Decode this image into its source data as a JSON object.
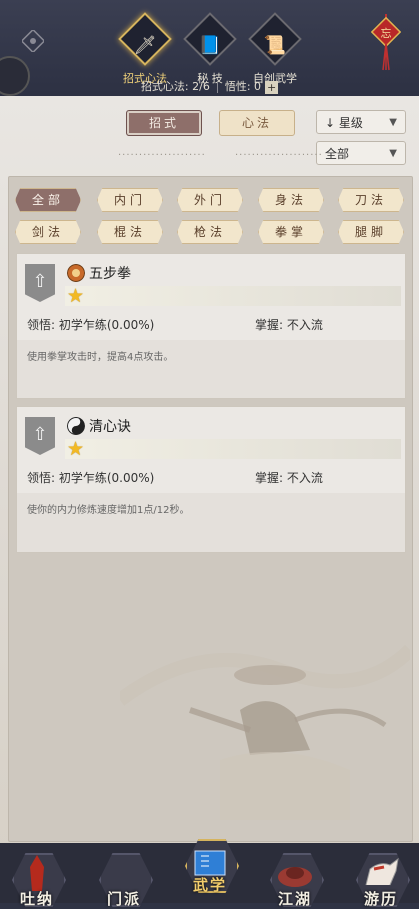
{
  "header": {
    "tabs": [
      {
        "label": "招式心法",
        "icon": "sword-icon",
        "active": true
      },
      {
        "label": "秘 技",
        "icon": "book-icon",
        "active": false
      },
      {
        "label": "自创武学",
        "icon": "scroll-icon",
        "active": false
      }
    ],
    "stat_moves": "招式心法: 2/6",
    "stat_insight": "悟性: 0",
    "plus": "+",
    "charm_char": "忘"
  },
  "toggle": {
    "moves": "招式",
    "heart": "心法"
  },
  "sort": {
    "label": "星级",
    "arrow": "↓"
  },
  "filter_dropdown": "全部",
  "categories": [
    {
      "label": "全部",
      "selected": true
    },
    {
      "label": "内门"
    },
    {
      "label": "外门"
    },
    {
      "label": "身法"
    },
    {
      "label": "刀法"
    },
    {
      "label": "剑法"
    },
    {
      "label": "棍法"
    },
    {
      "label": "枪法"
    },
    {
      "label": "拳掌"
    },
    {
      "label": "腿脚"
    }
  ],
  "skills": [
    {
      "name": "五步拳",
      "icon": "fist-icon",
      "stars": 1,
      "insight": "领悟: 初学乍练(0.00%)",
      "mastery": "掌握: 不入流",
      "desc": "使用拳掌攻击时，提高4点攻击。"
    },
    {
      "name": "清心诀",
      "icon": "yin-yang-icon",
      "stars": 1,
      "insight": "领悟: 初学乍练(0.00%)",
      "mastery": "掌握: 不入流",
      "desc": "使你的内力修炼速度增加1点/12秒。"
    }
  ],
  "bottom_nav": [
    {
      "label": "吐纳",
      "active": false
    },
    {
      "label": "门派",
      "active": false
    },
    {
      "label": "武学",
      "active": true
    },
    {
      "label": "江湖",
      "active": false
    },
    {
      "label": "游历",
      "active": false
    }
  ],
  "colors": {
    "accent": "#d6b45e",
    "chip_selected": "#8e6f6a",
    "star": "#f2b924"
  }
}
